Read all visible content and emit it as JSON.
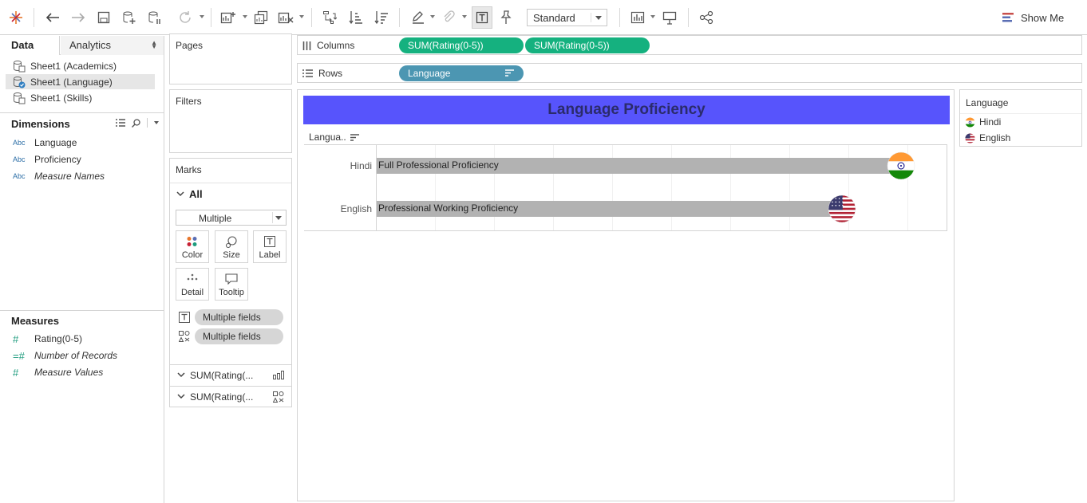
{
  "toolbar": {
    "standard_value": "Standard",
    "show_me_label": "Show Me"
  },
  "data_pane": {
    "tab_data": "Data",
    "tab_analytics": "Analytics",
    "datasources": [
      {
        "label": "Sheet1 (Academics)",
        "selected": false
      },
      {
        "label": "Sheet1 (Language)",
        "selected": true
      },
      {
        "label": "Sheet1 (Skills)",
        "selected": false
      }
    ],
    "dimensions_title": "Dimensions",
    "dimensions": [
      {
        "type": "Abc",
        "label": "Language",
        "italic": false
      },
      {
        "type": "Abc",
        "label": "Proficiency",
        "italic": false
      },
      {
        "type": "Abc",
        "label": "Measure Names",
        "italic": true
      }
    ],
    "measures_title": "Measures",
    "measures": [
      {
        "type": "#",
        "label": "Rating(0-5)",
        "italic": false
      },
      {
        "type": "=#",
        "label": "Number of Records",
        "italic": true
      },
      {
        "type": "#",
        "label": "Measure Values",
        "italic": true
      }
    ]
  },
  "cards": {
    "pages_title": "Pages",
    "filters_title": "Filters",
    "marks_title": "Marks",
    "marks_all": "All",
    "mark_type": "Multiple",
    "buttons": {
      "color": "Color",
      "size": "Size",
      "label": "Label",
      "detail": "Detail",
      "tooltip": "Tooltip"
    },
    "pill_1": "Multiple fields",
    "pill_2": "Multiple fields",
    "measure_1": "SUM(Rating(...",
    "measure_2": "SUM(Rating(..."
  },
  "shelves": {
    "columns_label": "Columns",
    "columns_pills": [
      "SUM(Rating(0-5))",
      "SUM(Rating(0-5))"
    ],
    "rows_label": "Rows",
    "rows_pill": "Language"
  },
  "view": {
    "title": "Language Proficiency",
    "column_header": "Langua..",
    "rows": [
      {
        "language": "Hindi",
        "proficiency": "Full Professional Proficiency"
      },
      {
        "language": "English",
        "proficiency": "Professional Working Proficiency"
      }
    ]
  },
  "legend": {
    "title": "Language",
    "items": [
      {
        "label": "Hindi",
        "flag": "india-flag-icon"
      },
      {
        "label": "English",
        "flag": "usa-flag-icon"
      }
    ]
  },
  "chart_data": {
    "type": "bar",
    "categories": [
      "Hindi",
      "English"
    ],
    "values": [
      4.5,
      4
    ],
    "data_labels": [
      "Full Professional Proficiency",
      "Professional Working Proficiency"
    ],
    "xlim": [
      0,
      5
    ],
    "grid": true,
    "bar_color": "#b2b2b2",
    "title": "Language Proficiency"
  }
}
